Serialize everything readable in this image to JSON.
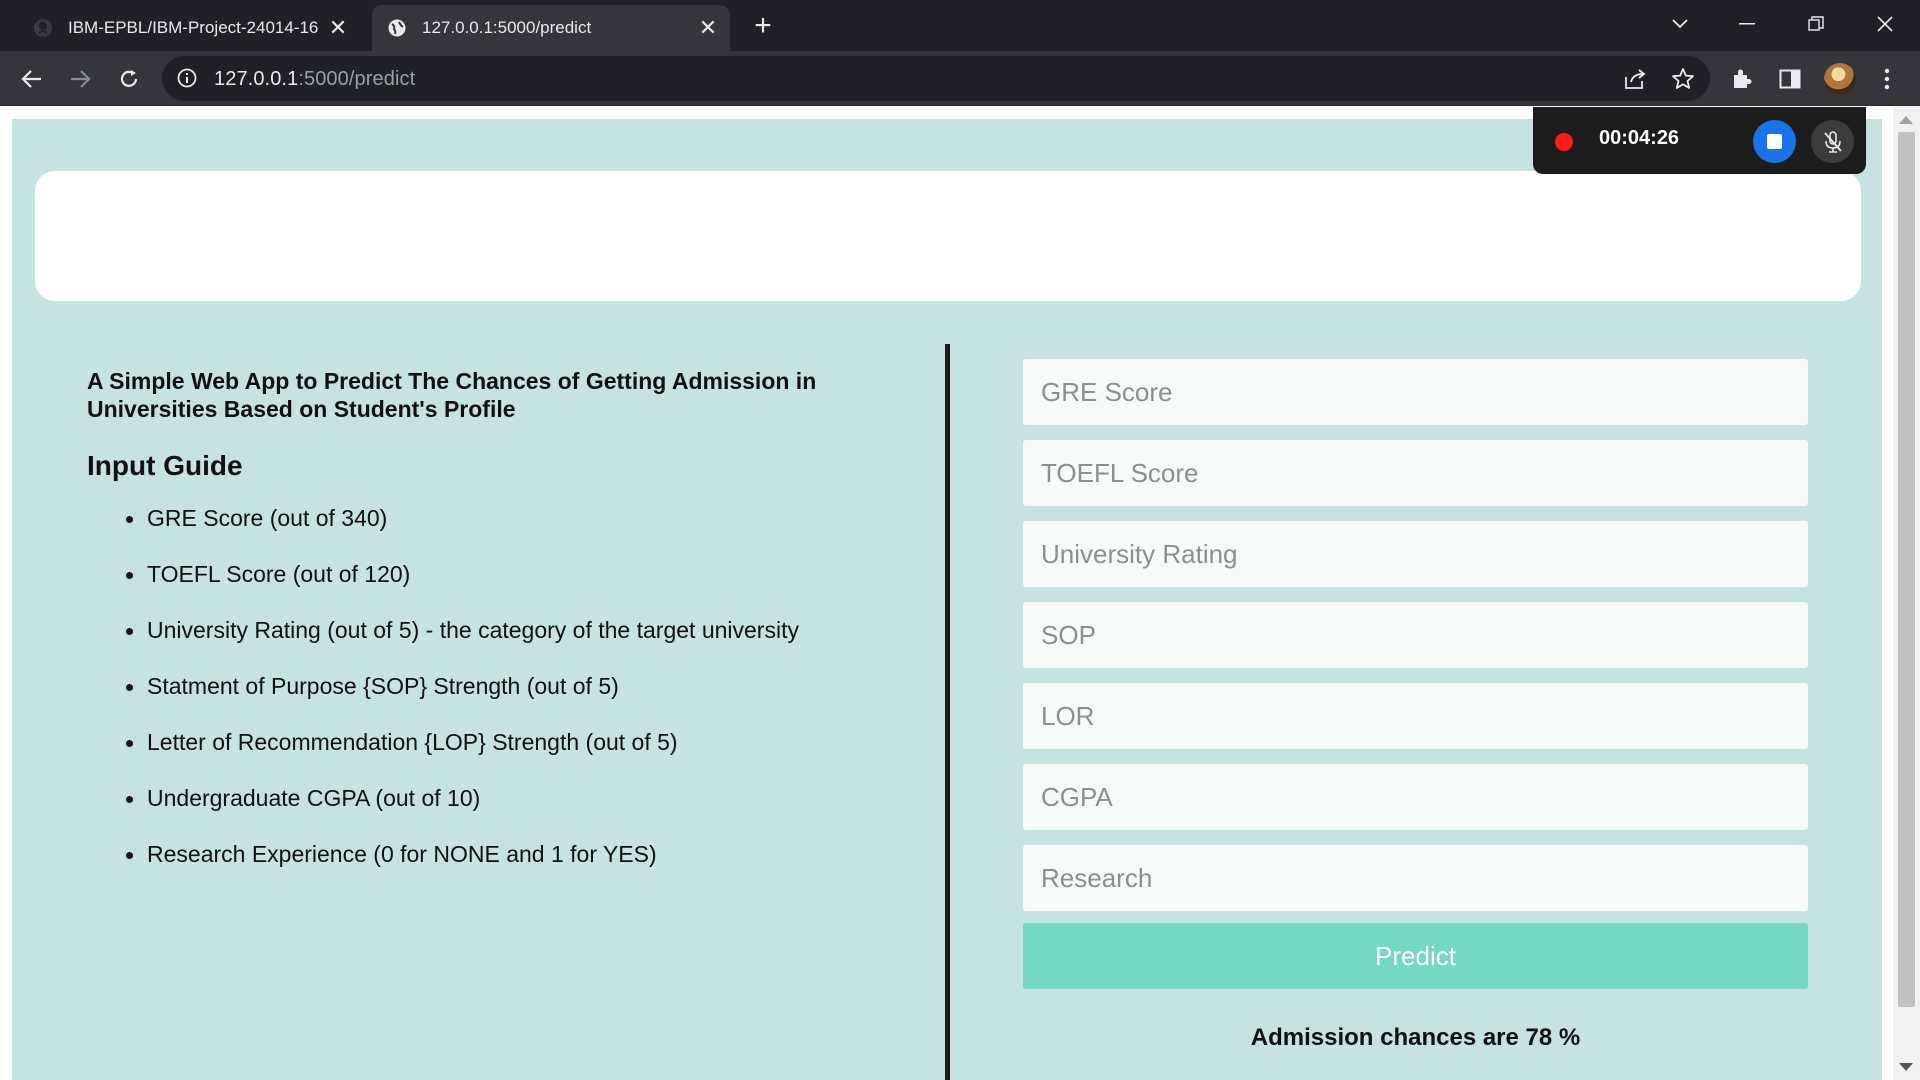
{
  "browser": {
    "tabs": [
      {
        "title": "IBM-EPBL/IBM-Project-24014-16",
        "favicon": "github-icon"
      },
      {
        "title": "127.0.0.1:5000/predict",
        "favicon": "globe-icon"
      }
    ],
    "url_host": "127.0.0.1",
    "url_path": ":5000/predict"
  },
  "recorder": {
    "time": "00:04:26"
  },
  "main": {
    "app_title": "A Simple Web App to Predict The Chances of Getting Admission in Universities Based on Student's Profile",
    "guide_heading": "Input Guide",
    "guide_items": [
      "GRE Score (out of 340)",
      "TOEFL Score (out of 120)",
      "University Rating (out of 5) - the category of the target university",
      "Statment of Purpose {SOP} Strength (out of 5)",
      "Letter of Recommendation {LOP} Strength (out of 5)",
      "Undergraduate CGPA (out of 10)",
      "Research Experience (0 for NONE and 1 for YES)"
    ]
  },
  "form": {
    "fields": [
      {
        "placeholder": "GRE Score",
        "value": ""
      },
      {
        "placeholder": "TOEFL Score",
        "value": ""
      },
      {
        "placeholder": "University Rating",
        "value": ""
      },
      {
        "placeholder": "SOP",
        "value": ""
      },
      {
        "placeholder": "LOR",
        "value": ""
      },
      {
        "placeholder": "CGPA",
        "value": ""
      },
      {
        "placeholder": "Research",
        "value": ""
      }
    ],
    "predict_label": "Predict",
    "result_text": "Admission chances are 78 %"
  },
  "colors": {
    "page_background": "#c6e2e1",
    "predict_button": "#74d8c2",
    "record_dot": "#ff1a1a",
    "stop_button": "#1a73e8"
  }
}
